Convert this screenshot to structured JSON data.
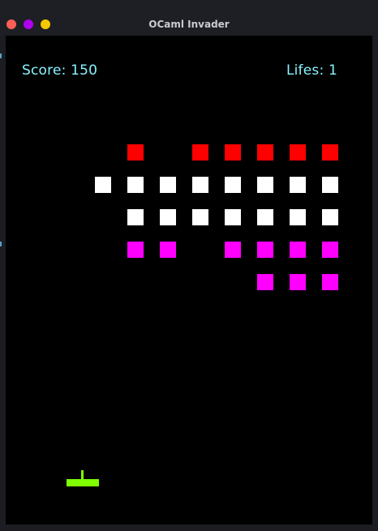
{
  "window": {
    "title": "OCaml Invader"
  },
  "colors": {
    "background": "#000000",
    "hud_text": "#88f3ff",
    "alien_red": "#ff0000",
    "alien_white": "#ffffff",
    "alien_magenta": "#ff00ff",
    "player": "#7fff00",
    "close": "#ff5f57",
    "minimize": "#b000f0",
    "zoom": "#f5c800"
  },
  "hud": {
    "score_label": "Score: 150",
    "lifes_label": "Lifes: 1"
  },
  "formation": {
    "rows": [
      {
        "color": "alien_red",
        "cells": [
          0,
          1,
          0,
          1,
          1,
          1,
          1,
          1
        ]
      },
      {
        "color": "alien_white",
        "cells": [
          1,
          1,
          1,
          1,
          1,
          1,
          1,
          1
        ]
      },
      {
        "color": "alien_white",
        "cells": [
          0,
          1,
          1,
          1,
          1,
          1,
          1,
          1
        ]
      },
      {
        "color": "alien_magenta",
        "cells": [
          0,
          1,
          1,
          0,
          1,
          1,
          1,
          1
        ]
      },
      {
        "color": "alien_magenta",
        "cells": [
          0,
          0,
          0,
          0,
          0,
          1,
          1,
          1
        ]
      }
    ]
  },
  "icons": {
    "close": "close-button-icon",
    "minimize": "minimize-button-icon",
    "zoom": "zoom-button-icon",
    "player": "player-cannon-icon",
    "alien": "alien-invader-icon"
  }
}
